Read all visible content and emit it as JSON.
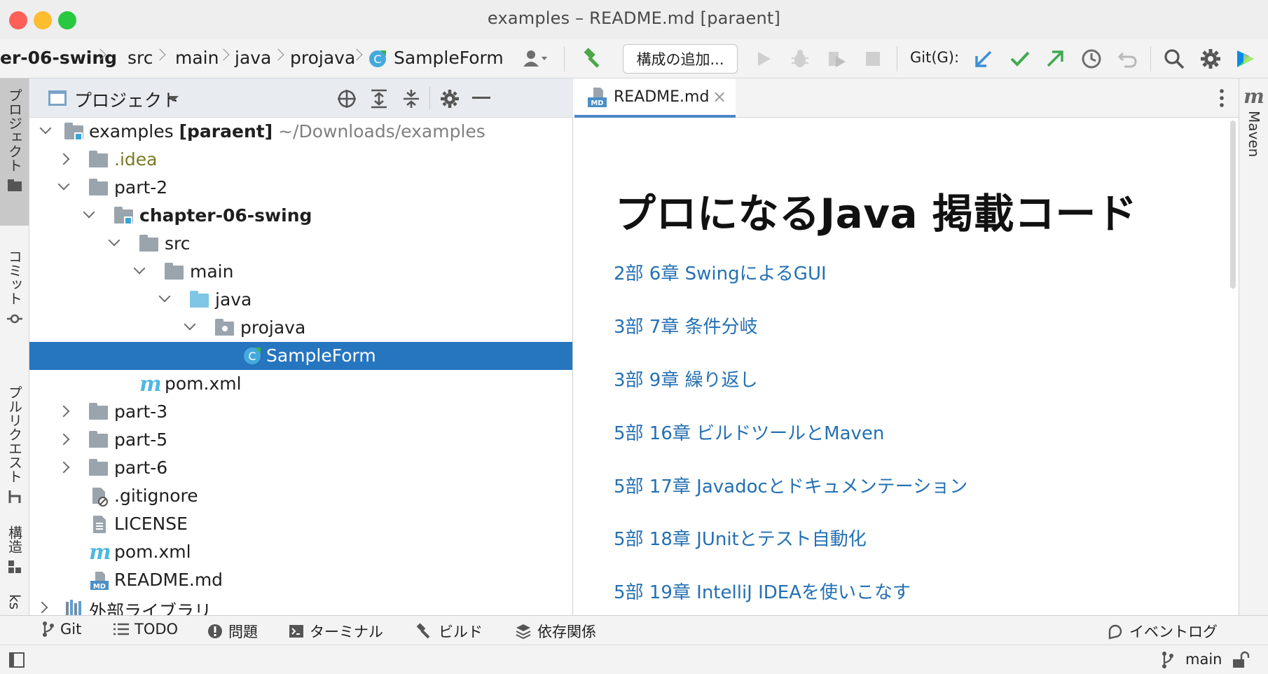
{
  "window": {
    "title": "examples – README.md [paraent]",
    "traffic_colors": [
      "#fe5f57",
      "#febc2e",
      "#28c840"
    ]
  },
  "breadcrumb": {
    "items": [
      "er-06-swing",
      "src",
      "main",
      "java",
      "projava",
      "SampleForm"
    ]
  },
  "toolbar": {
    "config_label": "構成の追加...",
    "git_label": "Git(G):",
    "icons": [
      "user-menu-icon",
      "build-hammer-icon",
      "run-icon",
      "debug-icon",
      "coverage-icon",
      "stop-icon",
      "git-update-icon",
      "git-commit-icon",
      "git-push-icon",
      "history-icon",
      "rollback-icon",
      "search-icon",
      "settings-icon",
      "jetbrains-logo-icon"
    ]
  },
  "left_strip": {
    "tabs": [
      "プロジェクト",
      "コミット",
      "プルリクエスト",
      "構造",
      "ks"
    ]
  },
  "right_strip": {
    "maven_label": "Maven"
  },
  "project_panel": {
    "title": "プロジェクト",
    "tree": [
      {
        "label": "examples",
        "bold_suffix": "[paraent]",
        "path": "~/Downloads/examples"
      },
      {
        "label": ".idea"
      },
      {
        "label": "part-2"
      },
      {
        "label": "chapter-06-swing"
      },
      {
        "label": "src"
      },
      {
        "label": "main"
      },
      {
        "label": "java"
      },
      {
        "label": "projava"
      },
      {
        "label": "SampleForm"
      },
      {
        "label": "pom.xml"
      },
      {
        "label": "part-3"
      },
      {
        "label": "part-5"
      },
      {
        "label": "part-6"
      },
      {
        "label": ".gitignore"
      },
      {
        "label": "LICENSE"
      },
      {
        "label": "pom.xml"
      },
      {
        "label": "README.md"
      },
      {
        "label": "外部ライブラリ"
      }
    ]
  },
  "editor": {
    "tab_label": "README.md",
    "tab_icon_text": "MD",
    "heading": "プロになるJava 掲載コード",
    "links": [
      "2部 6章 SwingによるGUI",
      "3部 7章 条件分岐",
      "3部 9章 繰り返し",
      "5部 16章 ビルドツールとMaven",
      "5部 17章 Javadocとドキュメンテーション",
      "5部 18章 JUnitとテスト自動化",
      "5部 19章 IntelliJ IDEAを使いこなす"
    ]
  },
  "bottom_tools": {
    "git": "Git",
    "todo": "TODO",
    "problems": "問題",
    "terminal": "ターミナル",
    "build": "ビルド",
    "dependencies": "依存関係",
    "event_log": "イベントログ"
  },
  "status": {
    "branch": "main"
  },
  "colors": {
    "selection": "#2675bf",
    "link": "#2470b3",
    "idea_folder_text": "#7a7a26",
    "accent_tab": "#4a88c7"
  }
}
